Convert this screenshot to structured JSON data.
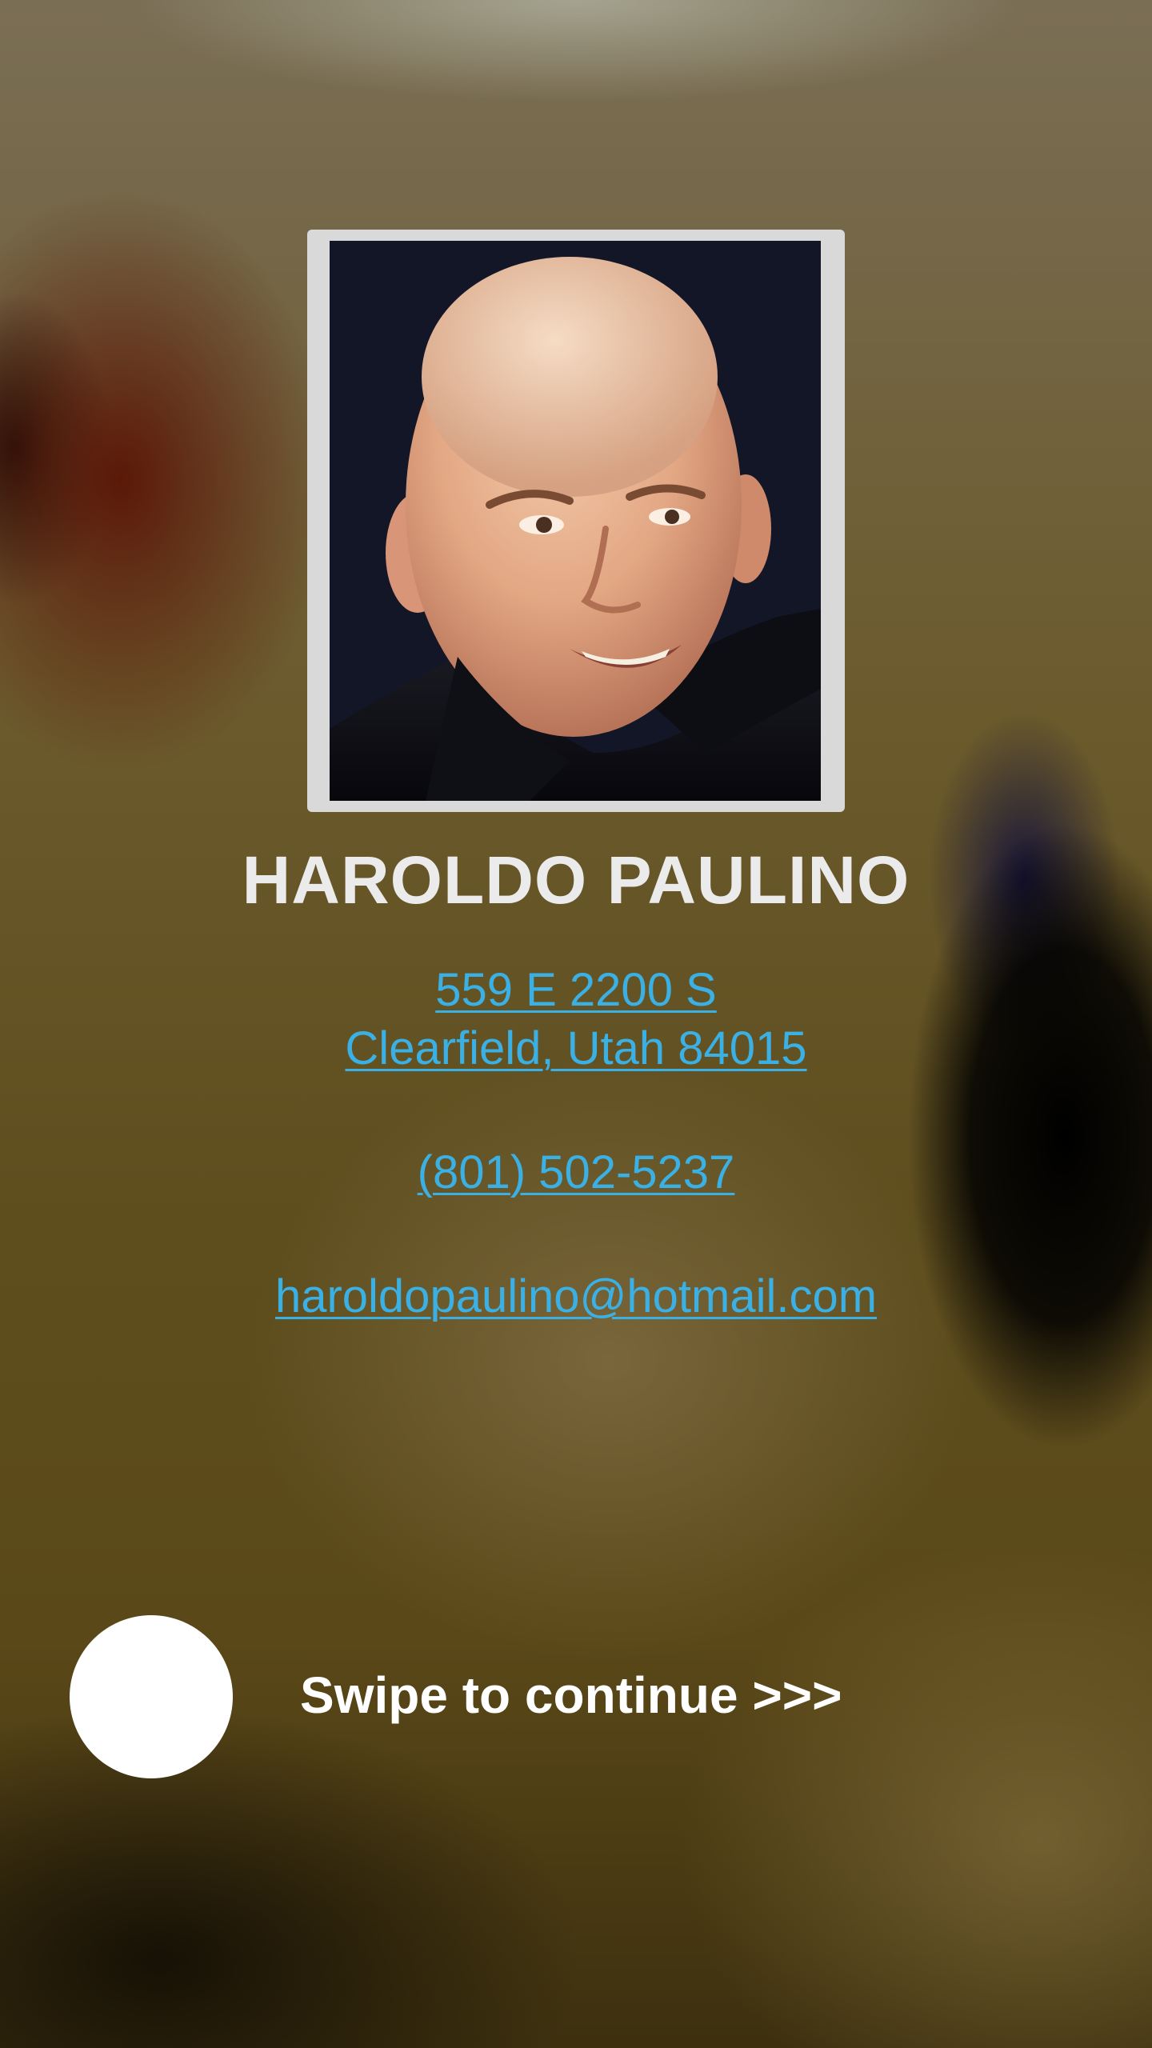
{
  "profile": {
    "name": "HAROLDO PAULINO",
    "address_line1": "559 E 2200 S",
    "address_line2": "Clearfield, Utah 84015",
    "phone": "(801) 502-5237",
    "email": "haroldopaulino@hotmail.com"
  },
  "swipe": {
    "label": "Swipe to continue >>>"
  },
  "colors": {
    "link": "#3bb0e4",
    "name_text": "#ebebeb",
    "frame": "#d9d9d9"
  }
}
